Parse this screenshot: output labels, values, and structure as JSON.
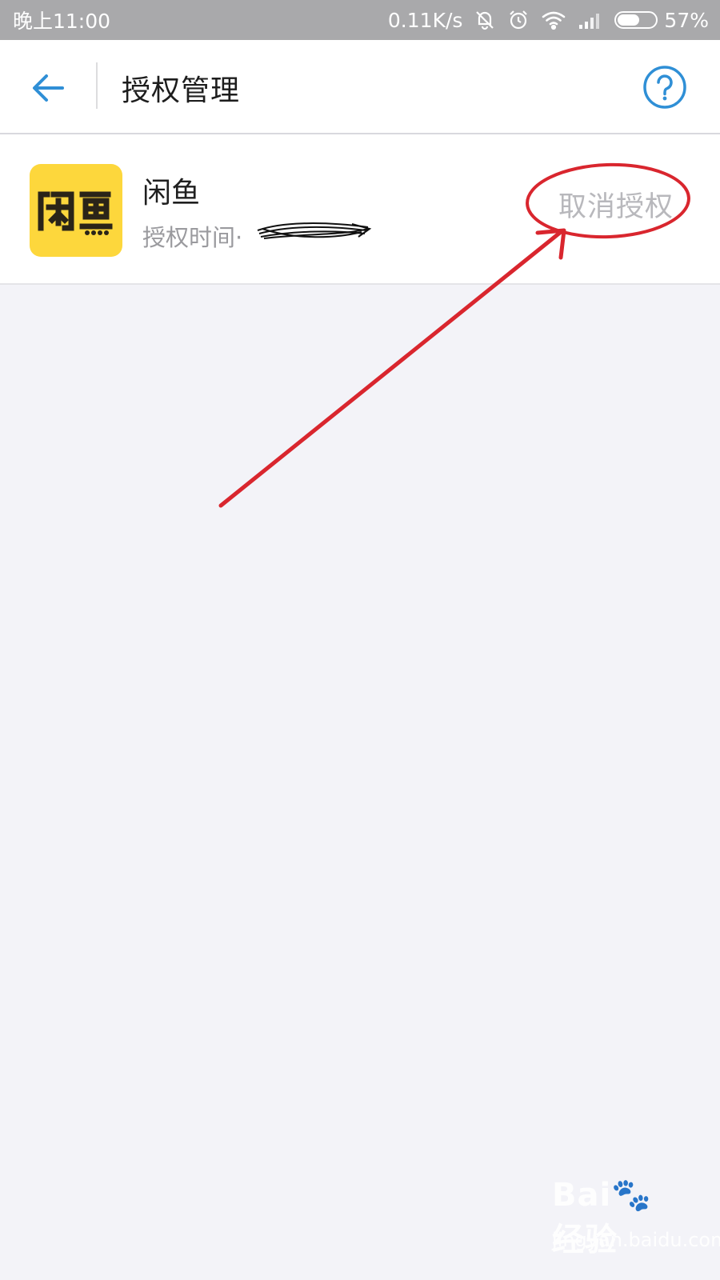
{
  "status_bar": {
    "time": "晚上11:00",
    "net_speed": "0.11K/s",
    "battery_percent": "57%",
    "battery_level": 0.57,
    "icons": [
      "bell-muted-icon",
      "alarm-icon",
      "wifi-icon",
      "signal-icon",
      "battery-icon"
    ]
  },
  "header": {
    "title": "授权管理",
    "back_icon": "arrow-left-icon",
    "help_icon": "help-circle-icon",
    "accent_color": "#2f8fd6"
  },
  "authorized_apps": [
    {
      "name": "闲鱼",
      "logo_text": "闲鱼",
      "auth_time_label": "授权时间·",
      "auth_time_value_redacted": true,
      "action_label": "取消授权",
      "icon_color": "#fdd73c"
    }
  ],
  "annotation": {
    "color": "#d9262e",
    "shapes": [
      "ellipse",
      "arrow"
    ]
  },
  "watermark": {
    "logo": "Bai🐾 经验",
    "url": "jingyan.baidu.com"
  }
}
